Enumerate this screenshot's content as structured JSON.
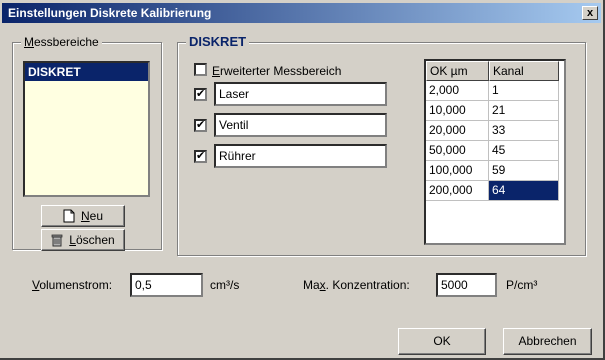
{
  "window": {
    "title": "Einstellungen Diskrete Kalibrierung",
    "close_label": "x"
  },
  "messbereiche": {
    "legend_pre": "",
    "legend_ul": "M",
    "legend_post": "essbereiche",
    "items": [
      "DISKRET"
    ],
    "new_ul": "N",
    "new_post": "eu",
    "delete_ul": "L",
    "delete_post": "öschen"
  },
  "diskret": {
    "legend": "DISKRET",
    "extended_ul": "E",
    "extended_post": "rweiterter Messbereich",
    "checks": [
      {
        "checked": "✔",
        "value": "Laser"
      },
      {
        "checked": "✔",
        "value": "Ventil"
      },
      {
        "checked": "✔",
        "value": "Rührer"
      }
    ]
  },
  "table": {
    "headers": [
      "OK µm",
      "Kanal"
    ],
    "rows": [
      [
        "2,000",
        "1"
      ],
      [
        "10,000",
        "21"
      ],
      [
        "20,000",
        "33"
      ],
      [
        "50,000",
        "45"
      ],
      [
        "100,000",
        "59"
      ],
      [
        "200,000",
        "64"
      ]
    ]
  },
  "volumenstrom": {
    "label_ul": "V",
    "label_post": "olumenstrom:",
    "value": "0,5",
    "unit": "cm³/s"
  },
  "konzentration": {
    "label_pre": "Ma",
    "label_ul": "x",
    "label_post": ". Konzentration:",
    "value": "5000",
    "unit": "P/cm³"
  },
  "buttons": {
    "ok": "OK",
    "cancel": "Abbrechen"
  },
  "colors": {
    "selection": "#0a246a",
    "face": "#d4d0c8",
    "listbox": "#ffffe1"
  }
}
